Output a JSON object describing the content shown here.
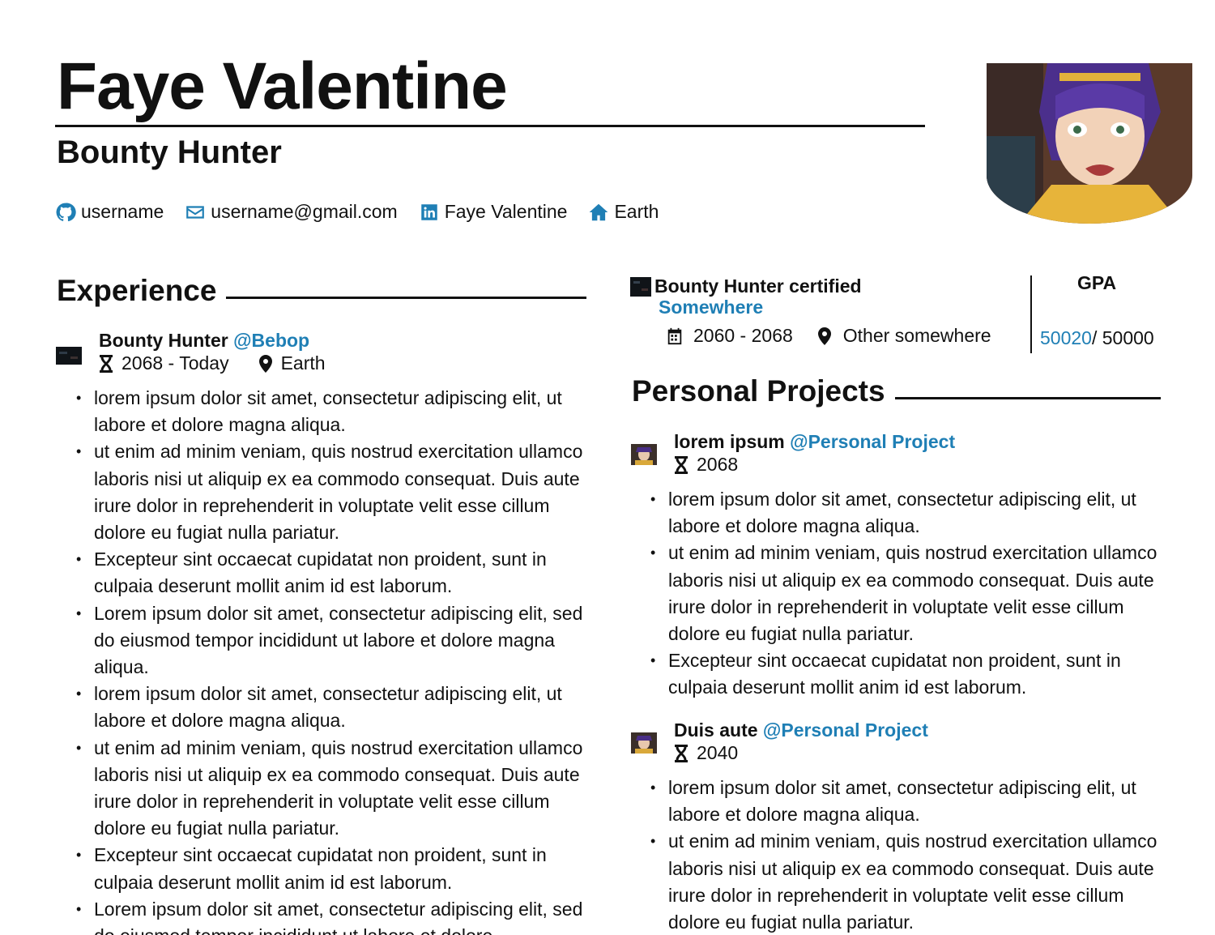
{
  "header": {
    "name": "Faye Valentine",
    "role": "Bounty Hunter",
    "avatar_icon": "avatar-portrait",
    "contacts": [
      {
        "icon": "github-icon",
        "label": "username"
      },
      {
        "icon": "mail-icon",
        "label": "username@gmail.com"
      },
      {
        "icon": "linkedin-icon",
        "label": "Faye Valentine"
      },
      {
        "icon": "home-icon",
        "label": "Earth"
      }
    ]
  },
  "colors": {
    "accent": "#1f7fb5",
    "text": "#111111"
  },
  "experience": {
    "title": "Experience",
    "entries": [
      {
        "role": "Bounty Hunter",
        "org": "@Bebop",
        "dates": "2068 - Today",
        "location": "Earth",
        "bullets": [
          "lorem ipsum dolor sit amet, consectetur adipiscing elit, ut labore et dolore magna aliqua.",
          "ut enim ad minim veniam, quis nostrud exercitation ullamco laboris nisi ut aliquip ex ea commodo consequat. Duis aute irure dolor in reprehenderit in voluptate velit esse cillum dolore eu fugiat nulla pariatur.",
          "Excepteur sint occaecat cupidatat non proident, sunt in culpaia deserunt mollit anim id est laborum.",
          "Lorem ipsum dolor sit amet, consectetur adipiscing elit, sed do eiusmod tempor incididunt ut labore et dolore magna aliqua.",
          "lorem ipsum dolor sit amet, consectetur adipiscing elit, ut labore et dolore magna aliqua.",
          "ut enim ad minim veniam, quis nostrud exercitation ullamco laboris nisi ut aliquip ex ea commodo consequat. Duis aute irure dolor in reprehenderit in voluptate velit esse cillum dolore eu fugiat nulla pariatur.",
          "Excepteur sint occaecat cupidatat non proident, sunt in culpaia deserunt mollit anim id est laborum.",
          "Lorem ipsum dolor sit amet, consectetur adipiscing elit, sed do eiusmod tempor incididunt ut labore et dolore"
        ]
      }
    ]
  },
  "education": {
    "degree": "Bounty Hunter certified",
    "school": "Somewhere",
    "dates": "2060 - 2068",
    "location": "Other somewhere",
    "gpa_label": "GPA",
    "gpa_value": "50020",
    "gpa_max": "/ 50000"
  },
  "projects": {
    "title": "Personal Projects",
    "entries": [
      {
        "name": "lorem ipsum",
        "org": "@Personal Project",
        "date": "2068",
        "bullets": [
          "lorem ipsum dolor sit amet, consectetur adipiscing elit, ut labore et dolore magna aliqua.",
          "ut enim ad minim veniam, quis nostrud exercitation ullamco laboris nisi ut aliquip ex ea commodo consequat. Duis aute irure dolor in reprehenderit in voluptate velit esse cillum dolore eu fugiat nulla pariatur.",
          "Excepteur sint occaecat cupidatat non proident, sunt in culpaia deserunt mollit anim id est laborum."
        ]
      },
      {
        "name": "Duis aute",
        "org": "@Personal Project",
        "date": "2040",
        "bullets": [
          "lorem ipsum dolor sit amet, consectetur adipiscing elit, ut labore et dolore magna aliqua.",
          "ut enim ad minim veniam, quis nostrud exercitation ullamco laboris nisi ut aliquip ex ea commodo consequat. Duis aute irure dolor in reprehenderit in voluptate velit esse cillum dolore eu fugiat nulla pariatur."
        ]
      }
    ]
  }
}
